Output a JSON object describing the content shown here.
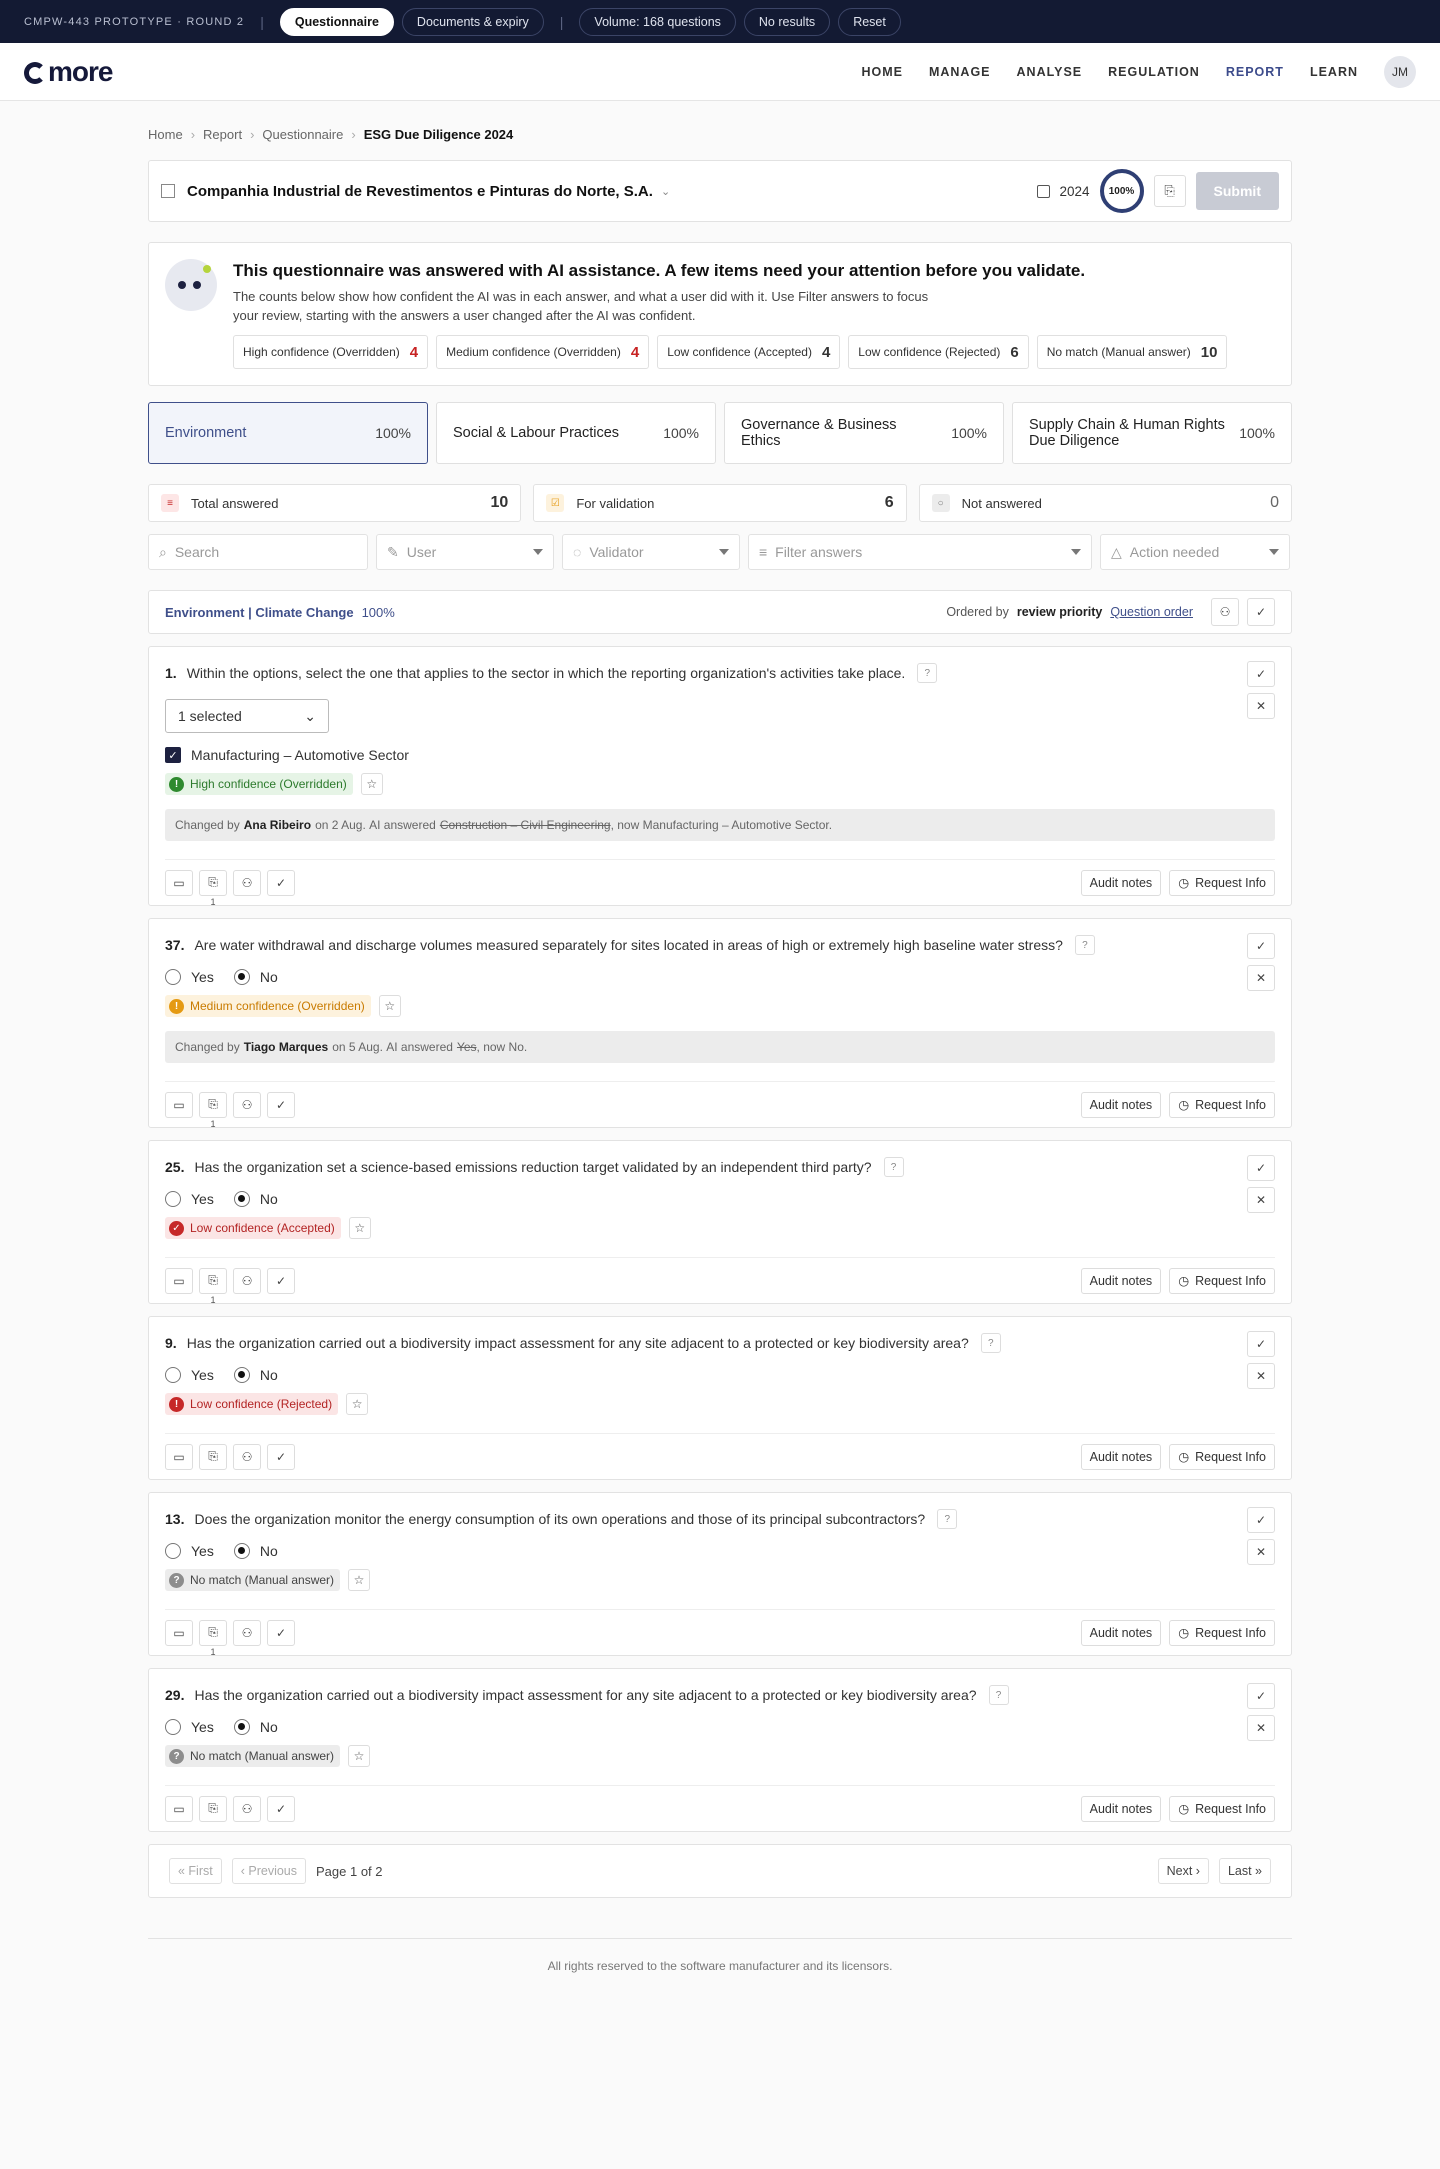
{
  "proto": {
    "tag": "CMPW-443 PROTOTYPE · ROUND 2",
    "pills": [
      "Questionnaire",
      "Documents & expiry"
    ],
    "pills2": [
      "Volume: 168 questions",
      "No results",
      "Reset"
    ]
  },
  "header": {
    "logo": "more",
    "nav": [
      "HOME",
      "MANAGE",
      "ANALYSE",
      "REGULATION",
      "REPORT",
      "LEARN"
    ],
    "avatar": "JM"
  },
  "breadcrumb": [
    "Home",
    "Report",
    "Questionnaire",
    "ESG Due Diligence 2024"
  ],
  "company": {
    "name": "Companhia Industrial de Revestimentos e Pinturas do Norte, S.A.",
    "year": "2024",
    "progress": "100%",
    "submit": "Submit"
  },
  "ai": {
    "title": "This questionnaire was answered with AI assistance. A few items need your attention before you validate.",
    "body": "The counts below show how confident the AI was in each answer, and what a user did with it. Use Filter answers to focus your review, starting with the answers a user changed after the AI was confident.",
    "chips": [
      {
        "label": "High confidence (Overridden)",
        "count": "4"
      },
      {
        "label": "Medium confidence (Overridden)",
        "count": "4"
      },
      {
        "label": "Low confidence (Accepted)",
        "count": "4"
      },
      {
        "label": "Low confidence (Rejected)",
        "count": "6"
      },
      {
        "label": "No match (Manual answer)",
        "count": "10"
      }
    ]
  },
  "tabs": [
    {
      "label": "Environment",
      "pct": "100%"
    },
    {
      "label": "Social & Labour Practices",
      "pct": "100%"
    },
    {
      "label": "Governance & Business Ethics",
      "pct": "100%"
    },
    {
      "label": "Supply Chain & Human Rights Due Diligence",
      "pct": "100%"
    }
  ],
  "stats": [
    {
      "label": "Total answered",
      "value": "10"
    },
    {
      "label": "For validation",
      "value": "6"
    },
    {
      "label": "Not answered",
      "value": "0"
    }
  ],
  "filters": {
    "search": "Search",
    "user": "User",
    "validator": "Validator",
    "filter": "Filter answers",
    "action": "Action needed"
  },
  "section": {
    "title": "Environment | Climate Change",
    "pct": "100%",
    "ordered_by": "Ordered by",
    "priority": "review priority",
    "question_order": "Question order"
  },
  "questions": [
    {
      "num": "1.",
      "text": "Within the options, select the one that applies to the sector in which the reporting organization's activities take place.",
      "select": "1 selected",
      "checked": "Manufacturing – Automotive Sector",
      "conf": "High confidence (Overridden)",
      "changed": {
        "pre": "Changed by",
        "user": "Ana Ribeiro",
        "on": "on 2 Aug.",
        "ai": "AI answered",
        "old": "Construction – Civil Engineering",
        "now": ", now Manufacturing – Automotive Sector."
      },
      "attach": "1"
    },
    {
      "num": "37.",
      "text": "Are water withdrawal and discharge volumes measured separately for sites located in areas of high or extremely high baseline water stress?",
      "yes": "Yes",
      "no": "No",
      "conf": "Medium confidence (Overridden)",
      "changed": {
        "pre": "Changed by",
        "user": "Tiago Marques",
        "on": "on 5 Aug.",
        "ai": "AI answered",
        "old": "Yes",
        "now": ", now No."
      },
      "attach": "1"
    },
    {
      "num": "25.",
      "text": "Has the organization set a science-based emissions reduction target validated by an independent third party?",
      "yes": "Yes",
      "no": "No",
      "conf": "Low confidence (Accepted)",
      "attach": "1"
    },
    {
      "num": "9.",
      "text": "Has the organization carried out a biodiversity impact assessment for any site adjacent to a protected or key biodiversity area?",
      "yes": "Yes",
      "no": "No",
      "conf": "Low confidence (Rejected)"
    },
    {
      "num": "13.",
      "text": "Does the organization monitor the energy consumption of its own operations and those of its principal subcontractors?",
      "yes": "Yes",
      "no": "No",
      "conf": "No match (Manual answer)",
      "attach": "1"
    },
    {
      "num": "29.",
      "text": "Has the organization carried out a biodiversity impact assessment for any site adjacent to a protected or key biodiversity area?",
      "yes": "Yes",
      "no": "No",
      "conf": "No match (Manual answer)"
    }
  ],
  "qactions": {
    "audit": "Audit notes",
    "request": "Request Info"
  },
  "pager": {
    "first": "« First",
    "prev": "‹ Previous",
    "info": "Page 1 of 2",
    "next": "Next ›",
    "last": "Last »"
  },
  "footer": "All rights reserved to the software manufacturer and its licensors."
}
